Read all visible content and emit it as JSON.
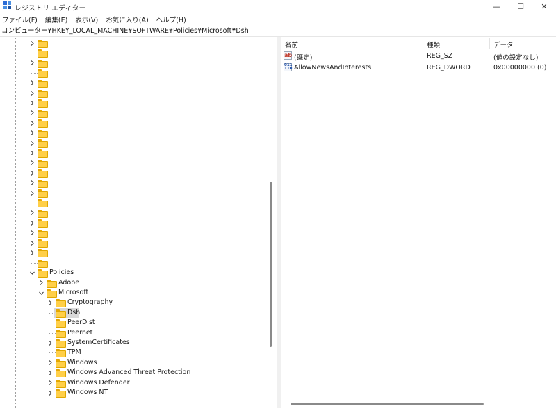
{
  "window": {
    "title": "レジストリ エディター",
    "minimize_glyph": "—",
    "maximize_glyph": "☐",
    "close_glyph": "✕"
  },
  "menu": [
    "ファイル(F)",
    "編集(E)",
    "表示(V)",
    "お気に入り(A)",
    "ヘルプ(H)"
  ],
  "address": "コンピューター¥HKEY_LOCAL_MACHINE¥SOFTWARE¥Policies¥Microsoft¥Dsh",
  "tree": {
    "policies_label": "Policies",
    "adobe_label": "Adobe",
    "microsoft_label": "Microsoft",
    "children": [
      {
        "label": "Cryptography",
        "expandable": true,
        "selected": false
      },
      {
        "label": "Dsh",
        "expandable": false,
        "selected": true
      },
      {
        "label": "PeerDist",
        "expandable": false,
        "selected": false
      },
      {
        "label": "Peernet",
        "expandable": false,
        "selected": false
      },
      {
        "label": "SystemCertificates",
        "expandable": true,
        "selected": false
      },
      {
        "label": "TPM",
        "expandable": false,
        "selected": false
      },
      {
        "label": "Windows",
        "expandable": true,
        "selected": false
      },
      {
        "label": "Windows Advanced Threat Protection",
        "expandable": true,
        "selected": false
      },
      {
        "label": "Windows Defender",
        "expandable": true,
        "selected": false
      },
      {
        "label": "Windows NT",
        "expandable": true,
        "selected": false
      }
    ],
    "unlabeled_rows": [
      true,
      false,
      true,
      false,
      true,
      true,
      true,
      true,
      true,
      true,
      true,
      true,
      true,
      true,
      true,
      true,
      false,
      true,
      true,
      true,
      true,
      true,
      false
    ]
  },
  "list": {
    "headers": {
      "name": "名前",
      "type": "種類",
      "data": "データ"
    },
    "rows": [
      {
        "icon": "string-value-icon",
        "icon_text": "ab",
        "name": "(既定)",
        "type": "REG_SZ",
        "data": "(値の設定なし)"
      },
      {
        "icon": "binary-value-icon",
        "icon_text": "011\n110",
        "name": "AllowNewsAndInterests",
        "type": "REG_DWORD",
        "data": "0x00000000 (0)"
      }
    ]
  },
  "colors": {
    "folder": "#ffcf48",
    "folder_border": "#e0a800",
    "selection": "#d9d9d9",
    "string_icon": "#c0392b",
    "binary_icon": "#1f4fa8"
  }
}
